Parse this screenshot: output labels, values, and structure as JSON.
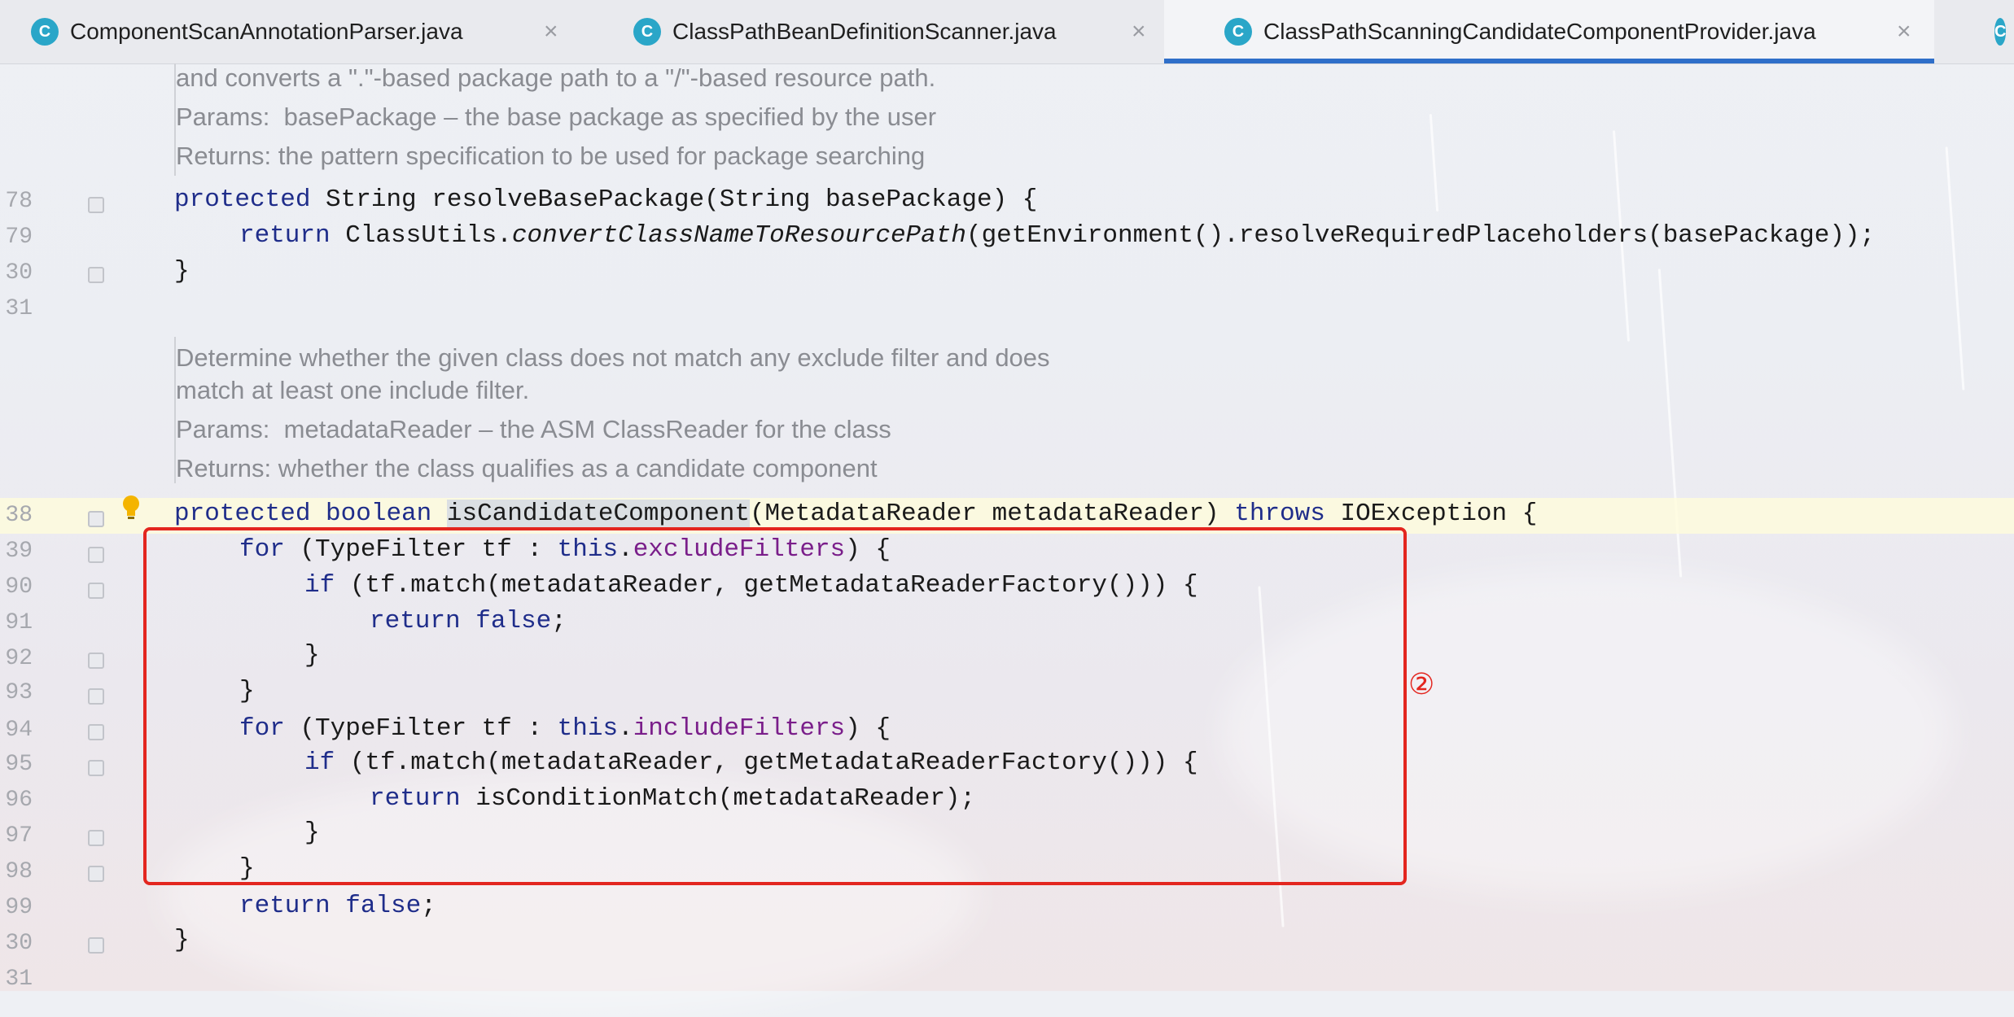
{
  "tabs": [
    {
      "label": "ComponentScanAnnotationParser.java",
      "icon": "class-c-icon"
    },
    {
      "label": "ClassPathBeanDefinitionScanner.java",
      "icon": "class-c-icon"
    },
    {
      "label": "ClassPathScanningCandidateComponentProvider.java",
      "icon": "class-c-icon",
      "active": true
    }
  ],
  "doc1": {
    "line1": "and converts a \".\"-based package path to a \"/\"-based resource path.",
    "params": "Params:  basePackage – the base package as specified by the user",
    "returns": "Returns: the pattern specification to be used for package searching"
  },
  "doc2": {
    "line1": "Determine whether the given class does not match any exclude filter and does",
    "line2": "match at least one include filter.",
    "params": "Params:  metadataReader – the ASM ClassReader for the class",
    "returns": "Returns: whether the class qualifies as a candidate component"
  },
  "line_numbers": [
    "78",
    "79",
    "30",
    "31",
    "38",
    "39",
    "90",
    "91",
    "92",
    "93",
    "94",
    "95",
    "96",
    "97",
    "98",
    "99",
    "30",
    "31"
  ],
  "code": {
    "l78_kw": "protected",
    "l78_rest": " String resolveBasePackage(String basePackage) {",
    "l79_kw": "return",
    "l79_a": " ClassUtils.",
    "l79_italic": "convertClassNameToResourcePath",
    "l79_b": "(getEnvironment().resolveRequiredPlaceholders(basePackage));",
    "l80": "}",
    "l88_kw1": "protected boolean",
    "l88_ident": "isCandidateComponent",
    "l88_mid": "(MetadataReader metadataReader) ",
    "l88_kw2": "throws",
    "l88_end": " IOException {",
    "l89_kw": "for",
    "l89_a": " (TypeFilter tf : ",
    "l89_this": "this",
    "l89_dot": ".",
    "l89_field": "excludeFilters",
    "l89_end": ") {",
    "l90_kw": "if",
    "l90_rest": " (tf.match(metadataReader, getMetadataReaderFactory())) {",
    "l91_kw": "return false",
    "l91_end": ";",
    "l92": "}",
    "l93": "}",
    "l94_kw": "for",
    "l94_a": " (TypeFilter tf : ",
    "l94_this": "this",
    "l94_dot": ".",
    "l94_field": "includeFilters",
    "l94_end": ") {",
    "l95_kw": "if",
    "l95_rest": " (tf.match(metadataReader, getMetadataReaderFactory())) {",
    "l96_kw": "return",
    "l96_rest": " isConditionMatch(metadataReader);",
    "l97": "}",
    "l98": "}",
    "l99_kw": "return false",
    "l99_end": ";",
    "l100": "}"
  },
  "annotation": {
    "marker": "②",
    "color": "#e3261f"
  },
  "colors": {
    "keyword": "#1f2d8a",
    "field": "#7a1e8a",
    "doc": "#8a8c92",
    "accent": "#2f6fc9"
  }
}
